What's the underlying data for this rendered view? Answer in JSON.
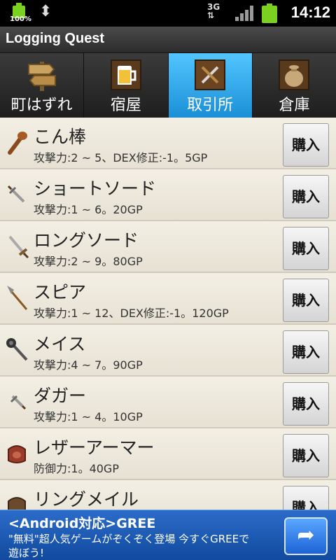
{
  "status_bar": {
    "battery_percent": "100%",
    "network": "3G",
    "time": "14:12"
  },
  "app": {
    "title": "Logging Quest"
  },
  "tabs": [
    {
      "label": "町はずれ",
      "icon": "signpost-icon",
      "active": false
    },
    {
      "label": "宿屋",
      "icon": "beer-mug-icon",
      "active": false
    },
    {
      "label": "取引所",
      "icon": "trading-sign-icon",
      "active": true
    },
    {
      "label": "倉庫",
      "icon": "sack-icon",
      "active": false
    }
  ],
  "items": [
    {
      "name": "こん棒",
      "desc": "攻撃力:2 ~ 5、DEX修正:-1。5GP",
      "buy_label": "購入",
      "icon": "club-icon"
    },
    {
      "name": "ショートソード",
      "desc": "攻撃力:1 ~ 6。20GP",
      "buy_label": "購入",
      "icon": "short-sword-icon"
    },
    {
      "name": "ロングソード",
      "desc": "攻撃力:2 ~ 9。80GP",
      "buy_label": "購入",
      "icon": "long-sword-icon"
    },
    {
      "name": "スピア",
      "desc": "攻撃力:1 ~ 12、DEX修正:-1。120GP",
      "buy_label": "購入",
      "icon": "spear-icon"
    },
    {
      "name": "メイス",
      "desc": "攻撃力:4 ~ 7。90GP",
      "buy_label": "購入",
      "icon": "mace-icon"
    },
    {
      "name": "ダガー",
      "desc": "攻撃力:1 ~ 4。10GP",
      "buy_label": "購入",
      "icon": "dagger-icon"
    },
    {
      "name": "レザーアーマー",
      "desc": "防御力:1。40GP",
      "buy_label": "購入",
      "icon": "leather-armor-icon"
    },
    {
      "name": "リングメイル",
      "desc": "",
      "buy_label": "購入",
      "icon": "ring-mail-icon"
    }
  ],
  "ad": {
    "headline": "<Android対応>GREE",
    "line1": "\"無料\"超人気ゲームがぞくぞく登場 今すぐGREEで",
    "line2": "遊ぼう!",
    "arrow_icon": "share-arrow-icon"
  },
  "colors": {
    "active_tab": "#2aa6ee",
    "list_background": "#ece8dc",
    "ad_background": "#1a57b3"
  }
}
